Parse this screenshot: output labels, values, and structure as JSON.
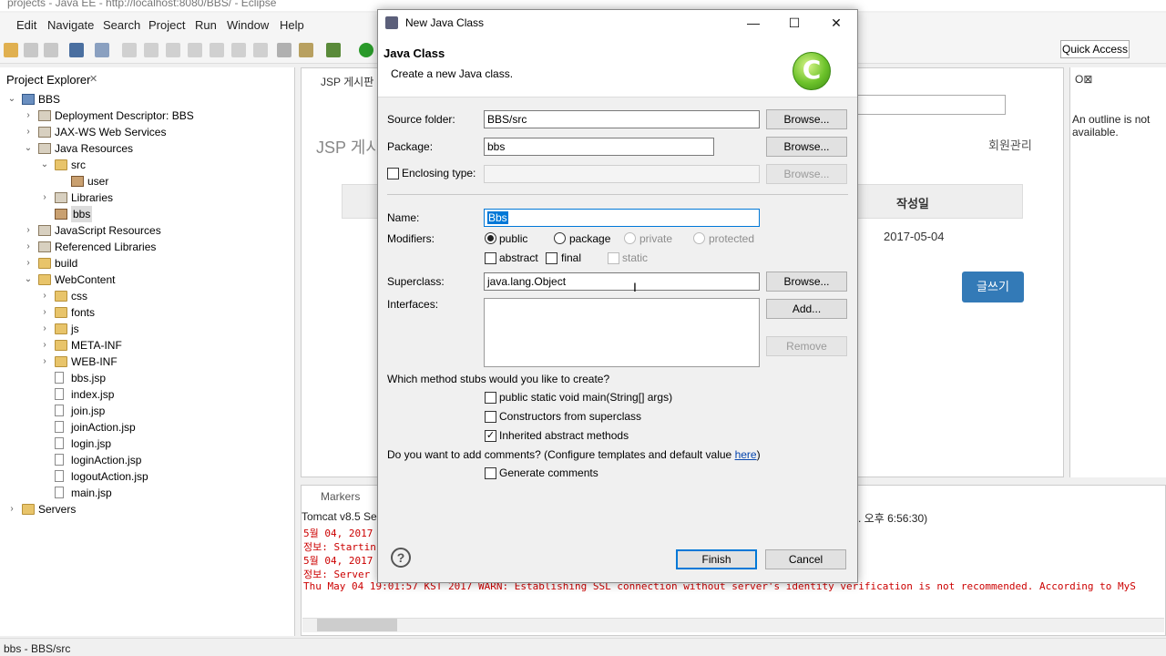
{
  "window": {
    "title": "projects - Java EE - http://localhost:8080/BBS/ - Eclipse"
  },
  "menu": [
    "Edit",
    "Navigate",
    "Search",
    "Project",
    "Run",
    "Window",
    "Help"
  ],
  "toolbar": {
    "quick_access": "Quick Access"
  },
  "explorer": {
    "tab_label": "Project Explorer",
    "tree": [
      {
        "label": "BBS",
        "icon": "project-icon",
        "level": 0,
        "twisty": "open"
      },
      {
        "label": "Deployment Descriptor: BBS",
        "icon": "descriptor-icon",
        "level": 1,
        "twisty": "closed"
      },
      {
        "label": "JAX-WS Web Services",
        "icon": "webservice-icon",
        "level": 1,
        "twisty": "closed"
      },
      {
        "label": "Java Resources",
        "icon": "java-resources-icon",
        "level": 1,
        "twisty": "open"
      },
      {
        "label": "src",
        "icon": "source-folder-icon",
        "level": 2,
        "twisty": "open"
      },
      {
        "label": "user",
        "icon": "package-icon",
        "level": 3,
        "twisty": "none"
      },
      {
        "label": "Libraries",
        "icon": "library-icon",
        "level": 2,
        "twisty": "closed"
      },
      {
        "label": "bbs",
        "icon": "package-icon",
        "level": 2,
        "twisty": "none",
        "selected": true
      },
      {
        "label": "JavaScript Resources",
        "icon": "js-resources-icon",
        "level": 1,
        "twisty": "closed"
      },
      {
        "label": "Referenced Libraries",
        "icon": "library-icon",
        "level": 1,
        "twisty": "closed"
      },
      {
        "label": "build",
        "icon": "folder-icon",
        "level": 1,
        "twisty": "closed"
      },
      {
        "label": "WebContent",
        "icon": "folder-icon",
        "level": 1,
        "twisty": "open"
      },
      {
        "label": "css",
        "icon": "folder-icon",
        "level": 2,
        "twisty": "closed"
      },
      {
        "label": "fonts",
        "icon": "folder-icon",
        "level": 2,
        "twisty": "closed"
      },
      {
        "label": "js",
        "icon": "folder-icon",
        "level": 2,
        "twisty": "closed"
      },
      {
        "label": "META-INF",
        "icon": "folder-icon",
        "level": 2,
        "twisty": "closed"
      },
      {
        "label": "WEB-INF",
        "icon": "folder-icon",
        "level": 2,
        "twisty": "closed"
      },
      {
        "label": "bbs.jsp",
        "icon": "jsp-file-icon",
        "level": 2,
        "twisty": "none"
      },
      {
        "label": "index.jsp",
        "icon": "jsp-file-icon",
        "level": 2,
        "twisty": "none"
      },
      {
        "label": "join.jsp",
        "icon": "jsp-file-icon",
        "level": 2,
        "twisty": "none"
      },
      {
        "label": "joinAction.jsp",
        "icon": "jsp-file-icon",
        "level": 2,
        "twisty": "none"
      },
      {
        "label": "login.jsp",
        "icon": "jsp-file-icon",
        "level": 2,
        "twisty": "none"
      },
      {
        "label": "loginAction.jsp",
        "icon": "jsp-file-icon",
        "level": 2,
        "twisty": "none"
      },
      {
        "label": "logoutAction.jsp",
        "icon": "jsp-file-icon",
        "level": 2,
        "twisty": "none"
      },
      {
        "label": "main.jsp",
        "icon": "jsp-file-icon",
        "level": 2,
        "twisty": "none"
      },
      {
        "label": "Servers",
        "icon": "folder-icon",
        "level": 0,
        "twisty": "closed"
      }
    ]
  },
  "editor": {
    "tab_label": "JSP 게시판",
    "heading": "JSP 게시",
    "member_menu": "회원관리",
    "col_date": "작성일",
    "row_date": "2017-05-04",
    "write_button": "글쓰기"
  },
  "outline": {
    "message": "An outline is not available."
  },
  "console": {
    "tab_label": "Markers",
    "header_left": "Tomcat v8.5 Se",
    "header_right": ". 오후 6:56:30)",
    "lines": [
      "5월 04, 2017",
      "정보: Startin",
      "5월 04, 2017",
      "정보: Server",
      "Thu May 04 19:01:57 KST 2017 WARN: Establishing SSL connection without server's identity verification is not recommended. According to MyS"
    ]
  },
  "statusbar": {
    "text": "bbs - BBS/src"
  },
  "dialog": {
    "title": "New Java Class",
    "heading": "Java Class",
    "subheading": "Create a new Java class.",
    "source_folder_label": "Source folder:",
    "source_folder_value": "BBS/src",
    "package_label": "Package:",
    "package_value": "bbs",
    "enclosing_type_label": "Enclosing type:",
    "browse_label": "Browse...",
    "name_label": "Name:",
    "name_value": "Bbs",
    "modifiers_label": "Modifiers:",
    "mod_public": "public",
    "mod_package": "package",
    "mod_private": "private",
    "mod_protected": "protected",
    "mod_abstract": "abstract",
    "mod_final": "final",
    "mod_static": "static",
    "superclass_label": "Superclass:",
    "superclass_value": "java.lang.Object",
    "interfaces_label": "Interfaces:",
    "add_label": "Add...",
    "remove_label": "Remove",
    "stubs_question": "Which method stubs would you like to create?",
    "stub_main": "public static void main(String[] args)",
    "stub_constructors": "Constructors from superclass",
    "stub_inherited": "Inherited abstract methods",
    "comments_question": "Do you want to add comments? (Configure templates and default value",
    "comments_link": "here",
    "comments_close": ")",
    "generate_comments": "Generate comments",
    "finish_label": "Finish",
    "cancel_label": "Cancel",
    "logo_letter": "C",
    "help_glyph": "?"
  }
}
